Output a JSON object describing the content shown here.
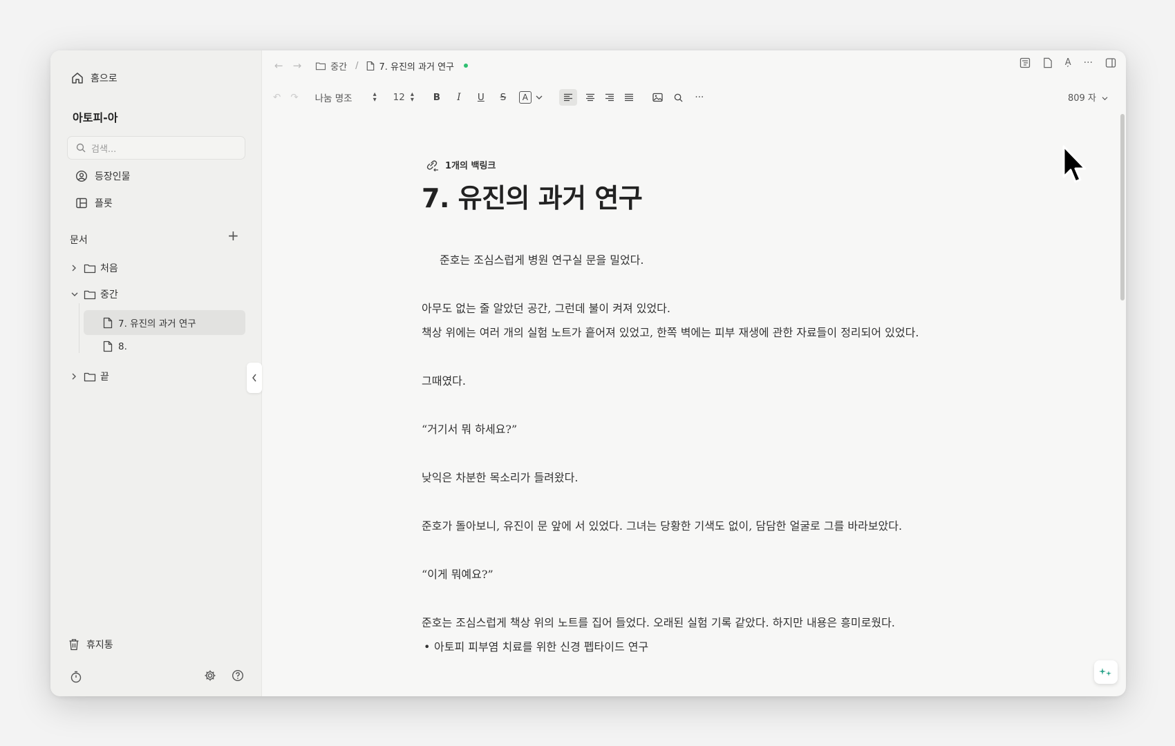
{
  "sidebar": {
    "home_label": "홈으로",
    "workspace_name": "아토피-아",
    "search_placeholder": "검색...",
    "items": [
      {
        "label": "등장인물"
      },
      {
        "label": "플롯"
      }
    ],
    "section_title": "문서",
    "add_symbol": "+",
    "tree": [
      {
        "label": "처음"
      },
      {
        "label": "중간"
      },
      {
        "label": "7. 유진의 과거 연구"
      },
      {
        "label": "8."
      },
      {
        "label": "끝"
      }
    ],
    "trash_label": "휴지통"
  },
  "topbar": {
    "breadcrumb_folder": "중간",
    "breadcrumb_sep": "/",
    "breadcrumb_doc": "7. 유진의 과거 연구",
    "status_color": "#2fbf71"
  },
  "toolbar": {
    "font_name": "나눔 명조",
    "font_size": "12",
    "bold": "B",
    "italic": "I",
    "underline": "U",
    "strike": "S",
    "text_color": "A",
    "char_count": "809 자"
  },
  "document": {
    "backlink_label": "1개의 백링크",
    "title": "7. 유진의 과거 연구",
    "paragraphs": [
      "준호는 조심스럽게 병원 연구실 문을 밀었다.",
      "",
      "아무도 없는 줄 알았던 공간, 그런데 불이 켜져 있었다.",
      "책상 위에는 여러 개의 실험 노트가 흩어져 있었고, 한쪽 벽에는 피부 재생에 관한 자료들이 정리되어 있었다.",
      "",
      "그때였다.",
      "",
      "“거기서 뭐 하세요?”",
      "",
      "낮익은 차분한 목소리가 들려왔다.",
      "",
      "준호가 돌아보니, 유진이 문 앞에 서 있었다. 그녀는 당황한 기색도 없이, 담담한 얼굴로 그를 바라보았다.",
      "",
      "“이게 뭐예요?”",
      "",
      "준호는 조심스럽게 책상 위의 노트를 집어 들었다. 오래된 실험 기록 같았다. 하지만 내용은 흥미로웠다.",
      "아토피 피부염 치료를 위한 신경 펩타이드 연구"
    ]
  },
  "fab_icon": "sparkle-icon",
  "accent_color": "#2aa38a"
}
